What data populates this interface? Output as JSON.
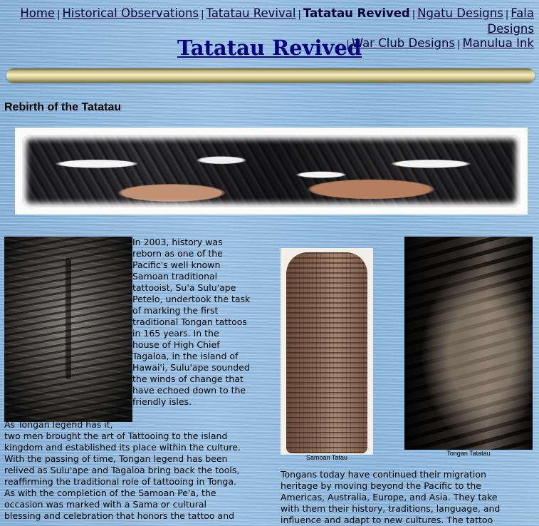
{
  "nav": {
    "items": [
      {
        "label": "Home",
        "current": false
      },
      {
        "label": "Historical Observations",
        "current": false
      },
      {
        "label": "Tatatau Revival",
        "current": false
      },
      {
        "label": "Tatatau Revived",
        "current": true
      },
      {
        "label": "Ngatu Designs",
        "current": false
      },
      {
        "label": "Fala Designs",
        "current": false
      },
      {
        "label": "War Club Designs",
        "current": false
      },
      {
        "label": "Manulua Ink",
        "current": false
      }
    ],
    "separator": "|"
  },
  "page": {
    "title": "Tatatau Revived",
    "section_heading": "Rebirth of the Tatatau"
  },
  "images": {
    "banner": "tattooing-ceremony-banner",
    "photo_left": "tattooed-legs-back",
    "photo_samoan": "samoan-pea-legs",
    "photo_tongan": "tongan-tattoo-legs",
    "caption_samoan": "Samoan Tatau",
    "caption_tongan": "Tongan Tatatau"
  },
  "text": {
    "para1": "In 2003, history was\nreborn as one of the\nPacific's well known\nSamoan traditional\ntattooist, Su'a Sulu'ape\nPetelo, undertook the task\nof marking the first\ntraditional Tongan tattoos\nin 165 years.  In the\nhouse of High Chief\nTagaloa, in the island of\nHawai'i, Sulu'ape sounded\nthe winds of change that\nhave echoed down to the\nfriendly isles.",
    "para2": "                              As Tongan legend has it,\ntwo men brought the art of Tattooing to the island\nkingdom and established its place within the culture.\nWith the passing of time, Tongan legend has been\nrelived as Sulu'ape and Tagaloa bring back the tools,\nreaffirming the traditional role of tattooing in Tonga.\nAs with the completion of the Samoan Pe'a, the\noccasion was marked with a Sama or cultural\nblessing and celebration that honors the tattoo and",
    "para3": "Tongans today have continued their migration\nheritage by moving beyond the Pacific to the\nAmericas, Australia, Europe, and Asia.  They take\nwith them their history, traditions, language, and\ninfluence and adapt to new cultures.  The tattoo"
  }
}
